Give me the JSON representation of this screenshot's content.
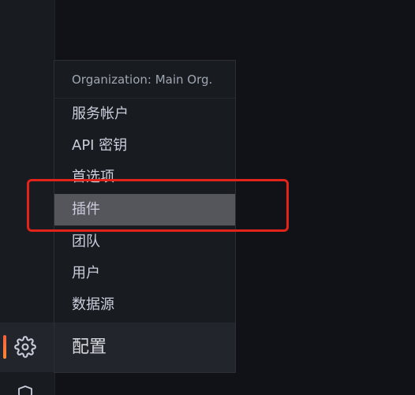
{
  "sidemenu": {
    "active_icon": "gear-icon",
    "partial_icon": "shield-icon",
    "accent_color": "#ff7a33"
  },
  "dropdown": {
    "header": "Organization: Main Org.",
    "items": [
      {
        "label": "服务帐户"
      },
      {
        "label": "API 密钥"
      },
      {
        "label": "首选项"
      },
      {
        "label": "插件",
        "hovered": true
      },
      {
        "label": "团队"
      },
      {
        "label": "用户"
      },
      {
        "label": "数据源"
      }
    ],
    "footer_label": "配置"
  },
  "annotation": {
    "color": "#e2231a",
    "target": "插件"
  }
}
